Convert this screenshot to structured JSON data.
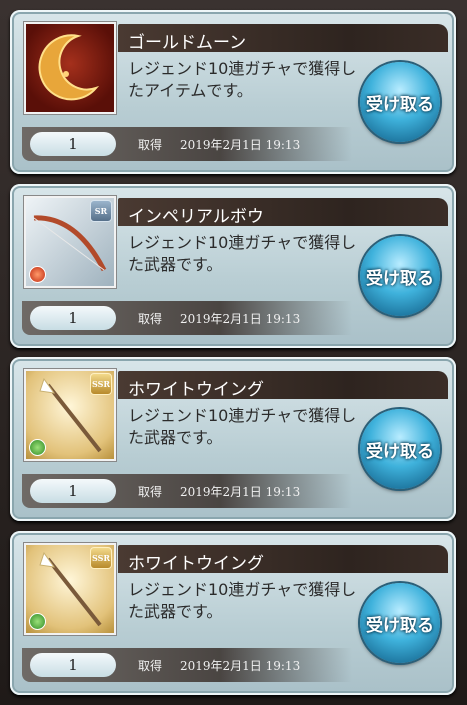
{
  "items": [
    {
      "name": "ゴールドムーン",
      "description": "レジェンド10連ガチャで獲得したアイテムです。",
      "quantity": "1",
      "acquired_label": "取得",
      "acquired_date": "2019年2月1日 19:13",
      "button_label": "受け取る",
      "thumb_kind": "item",
      "rarity": "",
      "element": ""
    },
    {
      "name": "インペリアルボウ",
      "description": "レジェンド10連ガチャで獲得した武器です。",
      "quantity": "1",
      "acquired_label": "取得",
      "acquired_date": "2019年2月1日 19:13",
      "button_label": "受け取る",
      "thumb_kind": "bow",
      "rarity": "SR",
      "element": "fire"
    },
    {
      "name": "ホワイトウイング",
      "description": "レジェンド10連ガチャで獲得した武器です。",
      "quantity": "1",
      "acquired_label": "取得",
      "acquired_date": "2019年2月1日 19:13",
      "button_label": "受け取る",
      "thumb_kind": "staff",
      "rarity": "SSR",
      "element": "wind"
    },
    {
      "name": "ホワイトウイング",
      "description": "レジェンド10連ガチャで獲得した武器です。",
      "quantity": "1",
      "acquired_label": "取得",
      "acquired_date": "2019年2月1日 19:13",
      "button_label": "受け取る",
      "thumb_kind": "staff",
      "rarity": "SSR",
      "element": "wind"
    }
  ]
}
